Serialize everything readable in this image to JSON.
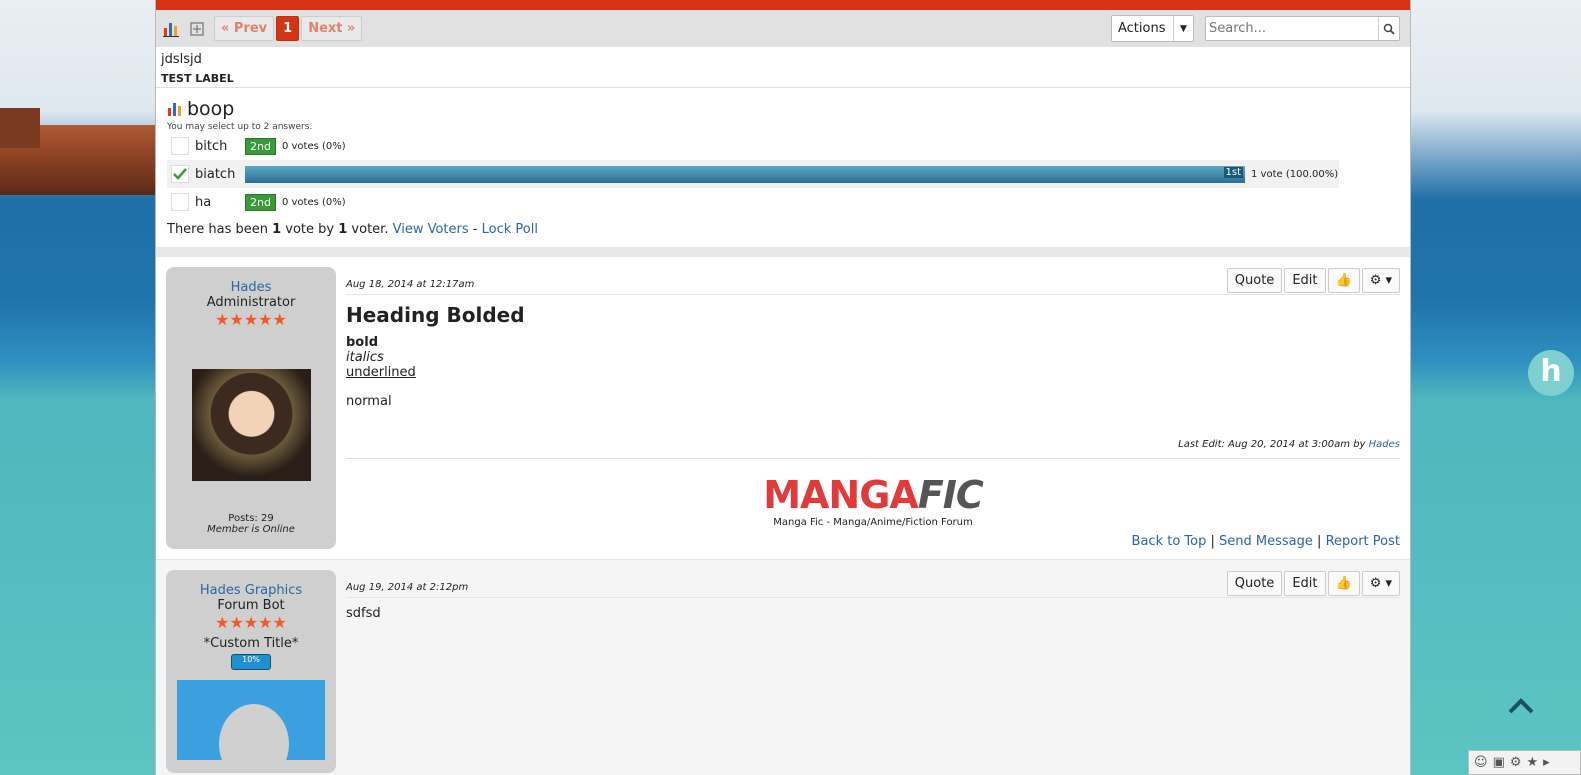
{
  "nav": {
    "prev": "« Prev",
    "page": "1",
    "next": "Next »",
    "actions": "Actions",
    "search_placeholder": "Search..."
  },
  "thread": {
    "title": "jdslsjd",
    "label": "TEST LABEL"
  },
  "poll": {
    "question": "boop",
    "hint": "You may select up to 2 answers.",
    "options": [
      {
        "label": "bitch",
        "rank": "2nd",
        "votes": "0 votes (0%)",
        "percent": 0,
        "selected": false
      },
      {
        "label": "biatch",
        "rank": "1st",
        "votes": "1 vote (100.00%)",
        "percent": 100,
        "selected": true
      },
      {
        "label": "ha",
        "rank": "2nd",
        "votes": "0 votes (0%)",
        "percent": 0,
        "selected": false
      }
    ],
    "footer_pre": "There has been ",
    "footer_n1": "1",
    "footer_mid": " vote by ",
    "footer_n2": "1",
    "footer_post": " voter.",
    "view_voters": "View Voters",
    "dash": "-",
    "lock_poll": "Lock Poll"
  },
  "posts": [
    {
      "name": "Hades",
      "role": "Administrator",
      "stars": "★★★★★",
      "posts_count": "Posts: 29",
      "status": "Member is Online",
      "date": "Aug 18, 2014 at 12:17am",
      "buttons": {
        "quote": "Quote",
        "edit": "Edit"
      },
      "heading": "Heading Bolded",
      "bold": "bold",
      "italics": "italics",
      "underlined": "underlined",
      "normal": "normal",
      "last_edit": "Last Edit: Aug 20, 2014 at 3:00am by ",
      "last_edit_by": "Hades",
      "sig_logo_a": "MANGA",
      "sig_logo_b": "FIC",
      "sig_caption": "Manga Fic - Manga/Anime/Fiction Forum",
      "footer": {
        "back": "Back to Top",
        "pipe1": "|",
        "send": "Send Message",
        "pipe2": "|",
        "report": "Report Post"
      }
    },
    {
      "name": "Hades Graphics",
      "role": "Forum Bot",
      "stars": "★★★★★",
      "custom_title": "*Custom Title*",
      "progress": "10%",
      "date": "Aug 19, 2014 at 2:12pm",
      "buttons": {
        "quote": "Quote",
        "edit": "Edit"
      },
      "text": "sdfsd"
    }
  ],
  "colors": {
    "accent": "#d33514",
    "link": "#2a66a5",
    "rank_bg": "#3a9b3a",
    "bar": "#2a6f92"
  }
}
